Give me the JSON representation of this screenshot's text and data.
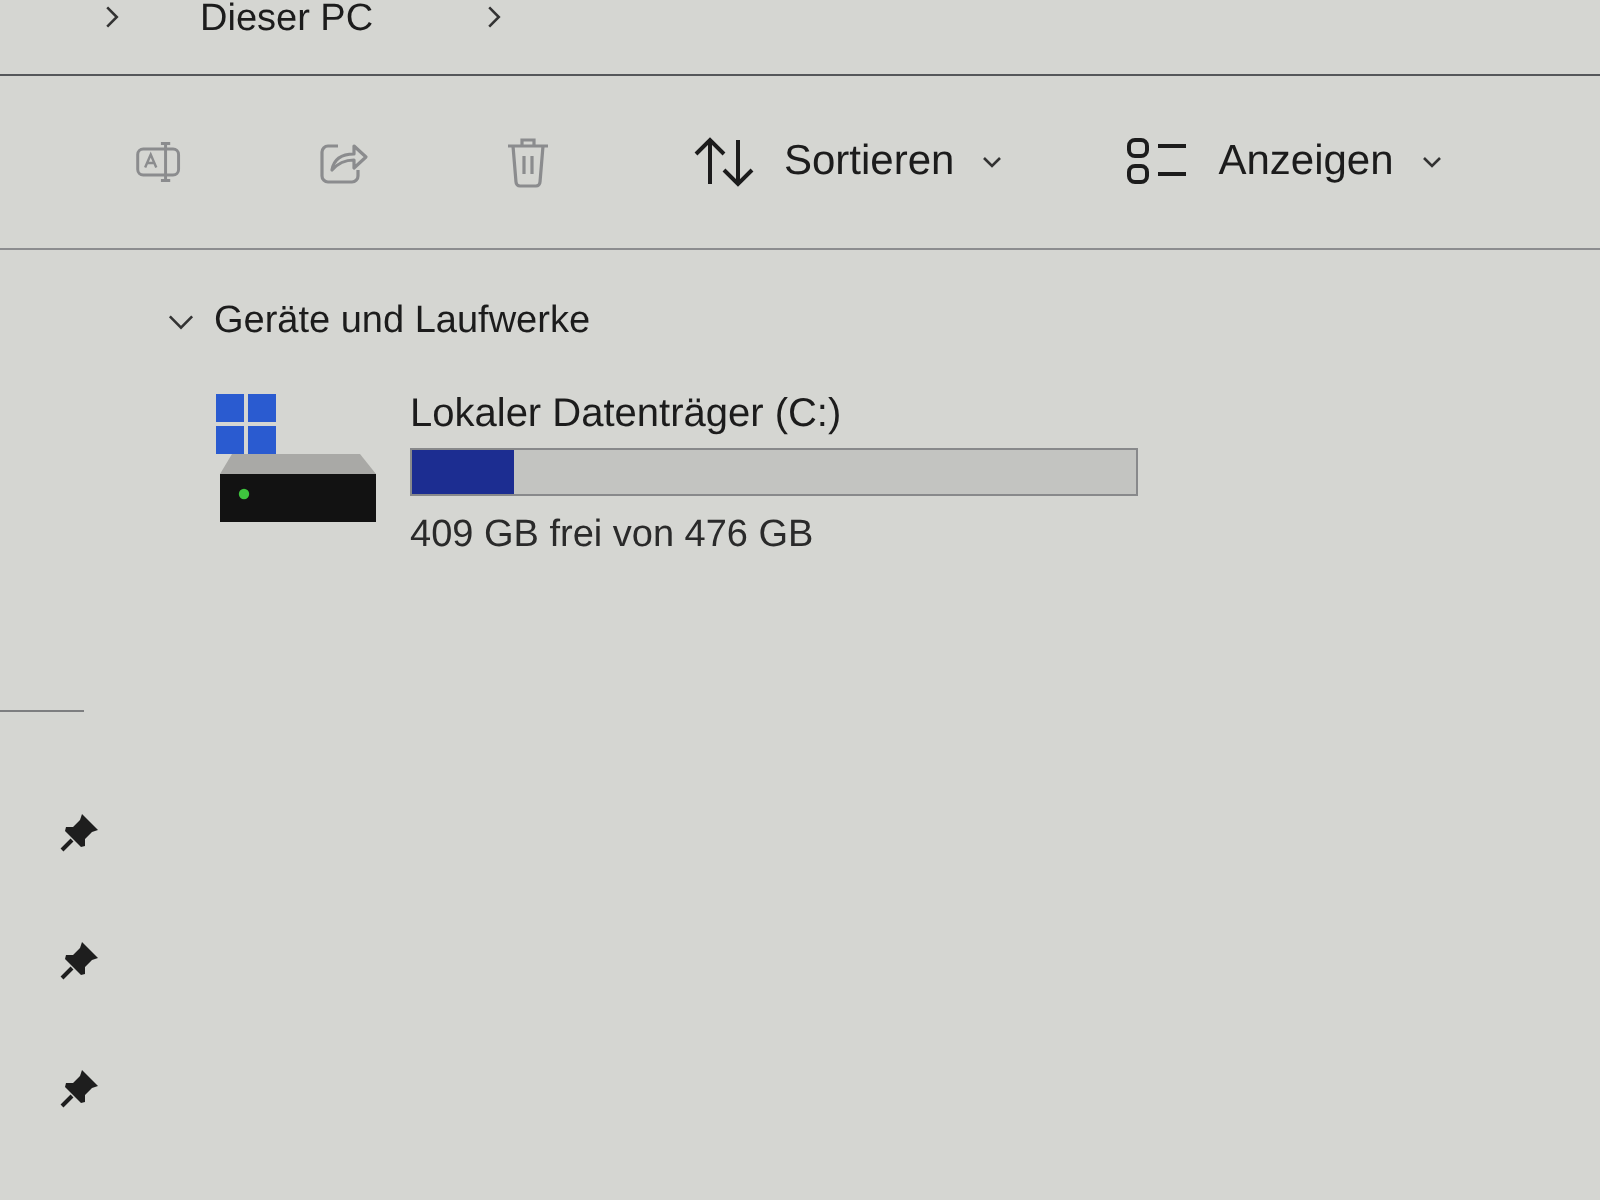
{
  "address_bar": {
    "breadcrumb": "Dieser PC"
  },
  "toolbar": {
    "buttons": [
      {
        "kind": "rename",
        "disabled": true
      },
      {
        "kind": "share",
        "disabled": true
      },
      {
        "kind": "delete",
        "disabled": true
      }
    ],
    "menus": [
      {
        "kind": "sort",
        "label": "Sortieren"
      },
      {
        "kind": "view",
        "label": "Anzeigen"
      }
    ]
  },
  "nav_pane": {
    "items": [
      {
        "pinned": true
      },
      {
        "pinned": true
      },
      {
        "pinned": true
      }
    ]
  },
  "section": {
    "title": "Geräte und Laufwerke",
    "expanded": true,
    "drives": [
      {
        "name": "Lokaler Datenträger (C:)",
        "level": 0.14,
        "caption": "409 GB frei von 476 GB"
      }
    ]
  }
}
